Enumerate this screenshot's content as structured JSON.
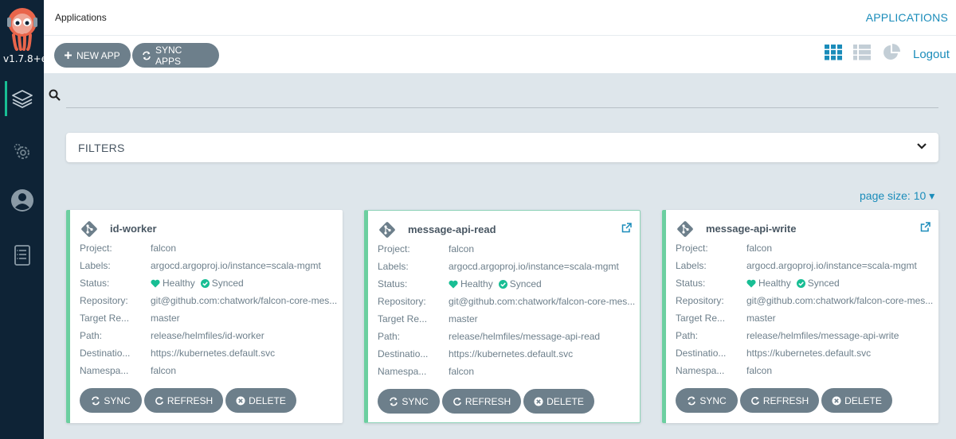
{
  "sidebar": {
    "version": "v1.7.8+e",
    "items": [
      {
        "label": "Applications",
        "icon": "layers-icon"
      },
      {
        "label": "Settings",
        "icon": "gear-icon"
      },
      {
        "label": "User Info",
        "icon": "user-icon"
      },
      {
        "label": "Documentation",
        "icon": "book-icon"
      }
    ]
  },
  "header": {
    "title": "Applications",
    "section": "APPLICATIONS"
  },
  "toolbar": {
    "new_app_label": "NEW APP",
    "sync_apps_label": "SYNC APPS",
    "logout_label": "Logout",
    "views": [
      "tiles",
      "list",
      "summary"
    ]
  },
  "search": {
    "placeholder": "",
    "value": ""
  },
  "filters": {
    "label": "FILTERS"
  },
  "pagination": {
    "page_size_label": "page size: 10"
  },
  "field_labels": {
    "project": "Project:",
    "labels": "Labels:",
    "status": "Status:",
    "repository": "Repository:",
    "target_revision": "Target Re...",
    "path": "Path:",
    "destination": "Destinatio...",
    "namespace": "Namespa..."
  },
  "card_actions": {
    "sync": "SYNC",
    "refresh": "REFRESH",
    "delete": "DELETE"
  },
  "apps": [
    {
      "name": "id-worker",
      "project": "falcon",
      "labels": "argocd.argoproj.io/instance=scala-mgmt",
      "health": "Healthy",
      "sync": "Synced",
      "repository": "git@github.com:chatwork/falcon-core-mes...",
      "target_revision": "master",
      "path": "release/helmfiles/id-worker",
      "destination": "https://kubernetes.default.svc",
      "namespace": "falcon"
    },
    {
      "name": "message-api-read",
      "project": "falcon",
      "labels": "argocd.argoproj.io/instance=scala-mgmt",
      "health": "Healthy",
      "sync": "Synced",
      "repository": "git@github.com:chatwork/falcon-core-mes...",
      "target_revision": "master",
      "path": "release/helmfiles/message-api-read",
      "destination": "https://kubernetes.default.svc",
      "namespace": "falcon"
    },
    {
      "name": "message-api-write",
      "project": "falcon",
      "labels": "argocd.argoproj.io/instance=scala-mgmt",
      "health": "Healthy",
      "sync": "Synced",
      "repository": "git@github.com:chatwork/falcon-core-mes...",
      "target_revision": "master",
      "path": "release/helmfiles/message-api-write",
      "destination": "https://kubernetes.default.svc",
      "namespace": "falcon"
    }
  ],
  "colors": {
    "sidebar_bg": "#0e2336",
    "accent": "#1a8cba",
    "healthy": "#18be94",
    "button": "#6d7f8b",
    "card_border": "#6ccfa0"
  }
}
